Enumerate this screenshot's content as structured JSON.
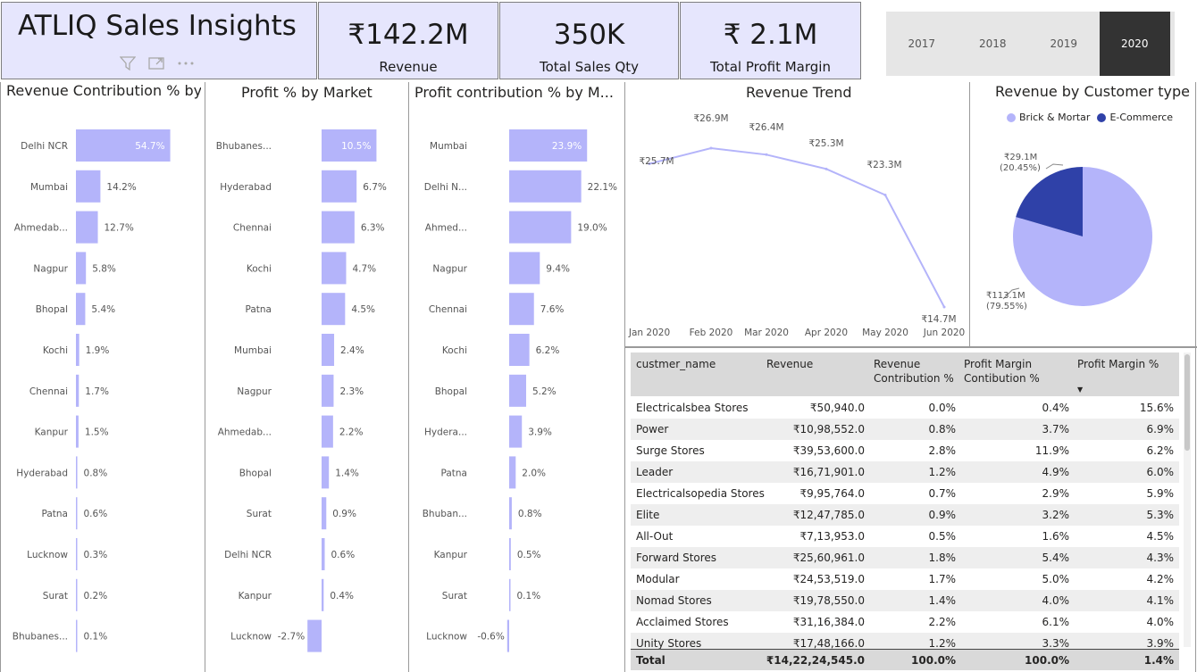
{
  "header": {
    "title": "ATLIQ Sales Insights",
    "kpis": [
      {
        "value": "₹142.2M",
        "label": "Revenue"
      },
      {
        "value": "350K",
        "label": "Total Sales Qty"
      },
      {
        "value": "₹ 2.1M",
        "label": "Total Profit Margin"
      }
    ],
    "year_slicer": {
      "options": [
        "2017",
        "2018",
        "2019",
        "2020"
      ],
      "selected": "2020"
    }
  },
  "colors": {
    "bar": "#b4b4fa",
    "ecommerce": "#2f41a8",
    "brick": "#b4b4fa",
    "line": "#b4b4fa"
  },
  "revenue_contribution": {
    "title": "Revenue Contribution % by...",
    "chart_data": {
      "type": "bar",
      "categories": [
        "Delhi NCR",
        "Mumbai",
        "Ahmedab...",
        "Nagpur",
        "Bhopal",
        "Kochi",
        "Chennai",
        "Kanpur",
        "Hyderabad",
        "Patna",
        "Lucknow",
        "Surat",
        "Bhubanes..."
      ],
      "values": [
        54.7,
        14.2,
        12.7,
        5.8,
        5.4,
        1.9,
        1.7,
        1.5,
        0.8,
        0.6,
        0.3,
        0.2,
        0.1
      ],
      "labels": [
        "54.7%",
        "14.2%",
        "12.7%",
        "5.8%",
        "5.4%",
        "1.9%",
        "1.7%",
        "1.5%",
        "0.8%",
        "0.6%",
        "0.3%",
        "0.2%",
        "0.1%"
      ]
    }
  },
  "profit_pct_market": {
    "title": "Profit % by Market",
    "chart_data": {
      "type": "bar",
      "categories": [
        "Bhubanes...",
        "Hyderabad",
        "Chennai",
        "Kochi",
        "Patna",
        "Mumbai",
        "Nagpur",
        "Ahmedab...",
        "Bhopal",
        "Surat",
        "Delhi NCR",
        "Kanpur",
        "Lucknow"
      ],
      "values": [
        10.5,
        6.7,
        6.3,
        4.7,
        4.5,
        2.4,
        2.3,
        2.2,
        1.4,
        0.9,
        0.6,
        0.4,
        -2.7
      ],
      "labels": [
        "10.5%",
        "6.7%",
        "6.3%",
        "4.7%",
        "4.5%",
        "2.4%",
        "2.3%",
        "2.2%",
        "1.4%",
        "0.9%",
        "0.6%",
        "0.4%",
        "-2.7%"
      ]
    }
  },
  "profit_contribution": {
    "title": "Profit contribution % by M...",
    "chart_data": {
      "type": "bar",
      "categories": [
        "Mumbai",
        "Delhi N...",
        "Ahmed...",
        "Nagpur",
        "Chennai",
        "Kochi",
        "Bhopal",
        "Hydera...",
        "Patna",
        "Bhuban...",
        "Kanpur",
        "Surat",
        "Lucknow"
      ],
      "values": [
        23.9,
        22.1,
        19.0,
        9.4,
        7.6,
        6.2,
        5.2,
        3.9,
        2.0,
        0.8,
        0.5,
        0.1,
        -0.6
      ],
      "labels": [
        "23.9%",
        "22.1%",
        "19.0%",
        "9.4%",
        "7.6%",
        "6.2%",
        "5.2%",
        "3.9%",
        "2.0%",
        "0.8%",
        "0.5%",
        "0.1%",
        "-0.6%"
      ]
    }
  },
  "revenue_trend": {
    "title": "Revenue Trend",
    "chart_data": {
      "type": "line",
      "x": [
        "Jan 2020",
        "Feb 2020",
        "Mar 2020",
        "Apr 2020",
        "May 2020",
        "Jun 2020"
      ],
      "values": [
        25.7,
        26.9,
        26.4,
        25.3,
        23.3,
        14.7
      ],
      "labels": [
        "₹25.7M",
        "₹26.9M",
        "₹26.4M",
        "₹25.3M",
        "₹23.3M",
        "₹14.7M"
      ]
    }
  },
  "customer_type": {
    "title": "Revenue by Customer type",
    "chart_data": {
      "type": "pie",
      "slices": [
        {
          "name": "Brick & Mortar",
          "value": 113.1,
          "label": "₹113.1M",
          "pct": "(79.55%)"
        },
        {
          "name": "E-Commerce",
          "value": 29.1,
          "label": "₹29.1M",
          "pct": "(20.45%)"
        }
      ]
    }
  },
  "table": {
    "columns": [
      "custmer_name",
      "Revenue",
      "Revenue Contribution %",
      "Profit Margin Contibution %",
      "Profit Margin %"
    ],
    "rows": [
      [
        "Electricalsbea Stores",
        "₹50,940.0",
        "0.0%",
        "0.4%",
        "15.6%"
      ],
      [
        "Power",
        "₹10,98,552.0",
        "0.8%",
        "3.7%",
        "6.9%"
      ],
      [
        "Surge Stores",
        "₹39,53,600.0",
        "2.8%",
        "11.9%",
        "6.2%"
      ],
      [
        "Leader",
        "₹16,71,901.0",
        "1.2%",
        "4.9%",
        "6.0%"
      ],
      [
        "Electricalsopedia Stores",
        "₹9,95,764.0",
        "0.7%",
        "2.9%",
        "5.9%"
      ],
      [
        "Elite",
        "₹12,47,785.0",
        "0.9%",
        "3.2%",
        "5.3%"
      ],
      [
        "All-Out",
        "₹7,13,953.0",
        "0.5%",
        "1.6%",
        "4.5%"
      ],
      [
        "Forward Stores",
        "₹25,60,961.0",
        "1.8%",
        "5.4%",
        "4.3%"
      ],
      [
        "Modular",
        "₹24,53,519.0",
        "1.7%",
        "5.0%",
        "4.2%"
      ],
      [
        "Nomad Stores",
        "₹19,78,550.0",
        "1.4%",
        "4.0%",
        "4.1%"
      ],
      [
        "Acclaimed Stores",
        "₹31,16,384.0",
        "2.2%",
        "6.1%",
        "4.0%"
      ],
      [
        "Unity Stores",
        "₹17,48,166.0",
        "1.2%",
        "3.3%",
        "3.9%"
      ]
    ],
    "total": [
      "Total",
      "₹14,22,24,545.0",
      "100.0%",
      "100.0%",
      "1.4%"
    ]
  }
}
